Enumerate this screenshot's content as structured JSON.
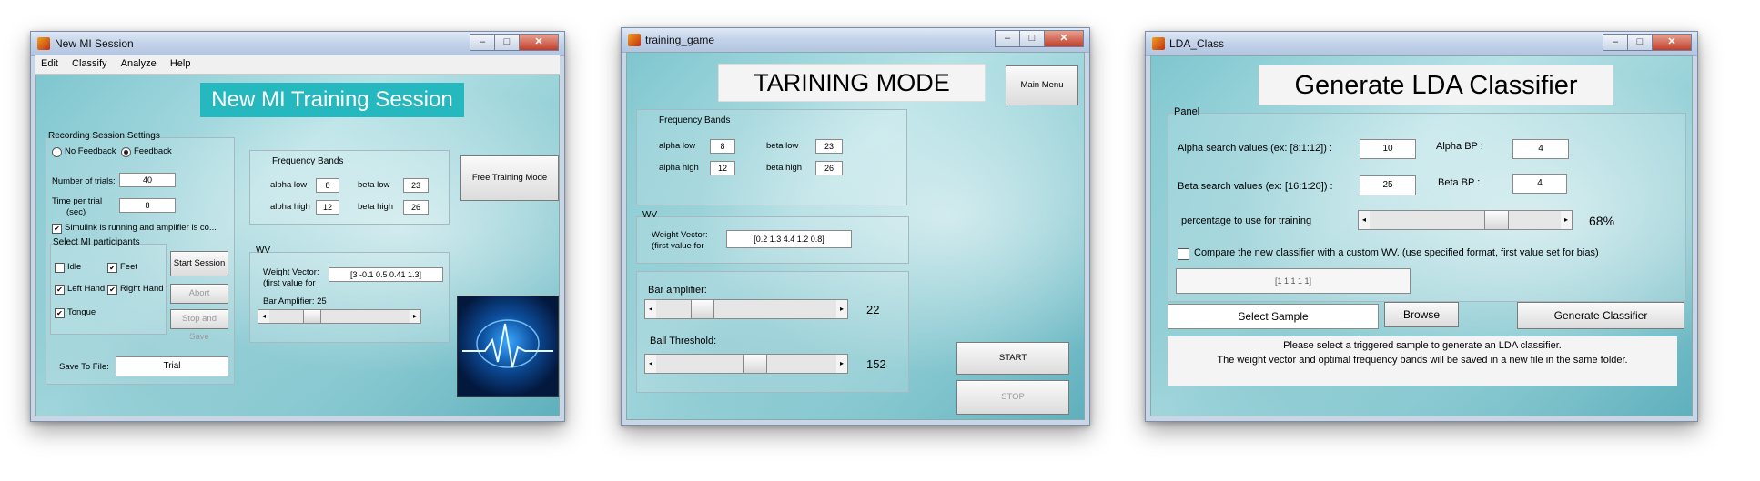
{
  "win1": {
    "title": "New MI Session",
    "menu": [
      "Edit",
      "Classify",
      "Analyze",
      "Help"
    ],
    "heading": "New MI Training Session",
    "recording_panel": "Recording Session Settings",
    "radio_nofeedback": "No Feedback",
    "radio_feedback": "Feedback",
    "num_trials_label": "Number of trials:",
    "num_trials": "40",
    "time_per_trial_label": "Time per trial",
    "time_per_trial_unit": "(sec)",
    "time_per_trial": "8",
    "simulink_label": "Simulink is running and amplifier is co...",
    "participants_panel": "Select MI participants",
    "idle": "Idle",
    "feet": "Feet",
    "left_hand": "Left Hand",
    "right_hand": "Right Hand",
    "tongue": "Tongue",
    "start_session": "Start Session",
    "abort": "Abort",
    "stop_and_save": "Stop and Save",
    "save_to_file_label": "Save To File:",
    "save_to_file": "Trial",
    "freq_bands_title": "Frequency Bands",
    "alpha_low_label": "alpha low",
    "alpha_low": "8",
    "beta_low_label": "beta low",
    "beta_low": "23",
    "alpha_high_label": "alpha high",
    "alpha_high": "12",
    "beta_high_label": "beta high",
    "beta_high": "26",
    "wv_panel": "WV",
    "weight_vector_label": "Weight Vector:",
    "first_value_label": "(first value for",
    "weight_vector": "[3 -0.1 0.5 0.41 1.3]",
    "bar_amplifier_label": "Bar Amplifier: 25",
    "bar_amplifier_level": 0.27,
    "free_training": "Free Training Mode"
  },
  "win2": {
    "title": "training_game",
    "heading": "TARINING MODE",
    "main_menu": "Main Menu",
    "freq_bands_title": "Frequency Bands",
    "alpha_low_label": "alpha low",
    "alpha_low": "8",
    "beta_low_label": "beta low",
    "beta_low": "23",
    "alpha_high_label": "alpha high",
    "alpha_high": "12",
    "beta_high_label": "beta high",
    "beta_high": "26",
    "wv_panel": "WV",
    "weight_vector_label": "Weight Vector:",
    "first_value_label": "(first value for",
    "weight_vector": "[0.2 1.3 4.4 1.2 0.8]",
    "bar_amplifier_label": "Bar amplifier:",
    "bar_amplifier_value": "22",
    "bar_amplifier_level": 0.22,
    "ball_threshold_label": "Ball   Threshold:",
    "ball_threshold_value": "152",
    "ball_threshold_level": 0.55,
    "start": "START",
    "stop": "STOP"
  },
  "win3": {
    "title": "LDA_Class",
    "heading": "Generate LDA Classifier",
    "panel_title": "Panel",
    "alpha_search_label": "Alpha search values (ex: [8:1:12]) :",
    "alpha_search": "10",
    "alpha_bp_label": "Alpha BP :",
    "alpha_bp": "4",
    "beta_search_label": "Beta search values (ex: [16:1:20]) :",
    "beta_search": "25",
    "beta_bp_label": "Beta BP :",
    "beta_bp": "4",
    "percentage_label": "percentage to use for training",
    "percentage_value": "68%",
    "percentage_level": 0.68,
    "compare_label": "Compare the new classifier with a custom WV. (use specified format, first value set for bias)",
    "custom_wv": "[1 1 1 1 1]",
    "select_sample": "Select Sample",
    "browse": "Browse",
    "generate": "Generate Classifier",
    "status_line1": "Please select a triggered sample to generate an LDA classifier.",
    "status_line2": "The weight vector and optimal frequency bands will be saved in a new file in the same folder."
  }
}
